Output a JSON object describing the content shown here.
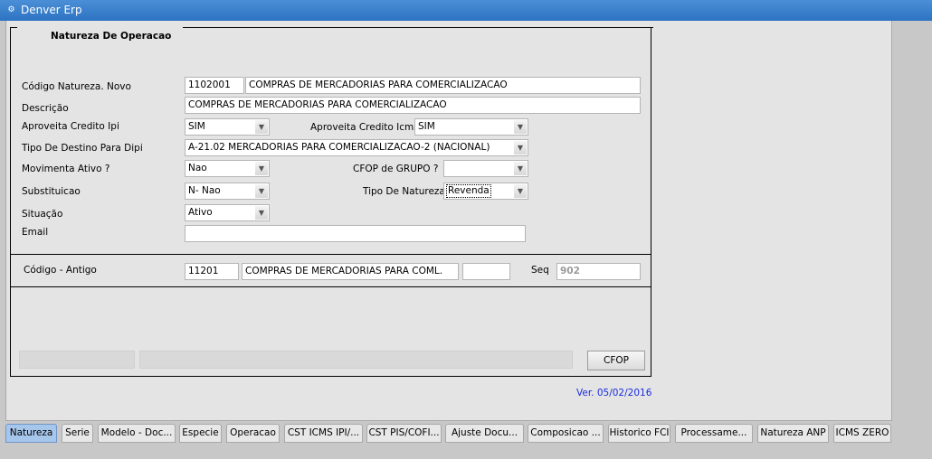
{
  "window": {
    "title": "Denver Erp",
    "icon": "app-icon"
  },
  "panel": {
    "title": "Natureza De Operacao"
  },
  "fields": {
    "codigo_novo": {
      "label": "Código Natureza. Novo",
      "code": "1102001",
      "desc": "COMPRAS DE MERCADORIAS PARA COMERCIALIZACAO"
    },
    "descricao": {
      "label": "Descrição",
      "value": "COMPRAS DE MERCADORIAS PARA COMERCIALIZACAO"
    },
    "aproveita_ipi": {
      "label": "Aproveita Credito Ipi",
      "value": "SIM"
    },
    "aproveita_icms": {
      "label": "Aproveita Credito Icms",
      "value": "SIM"
    },
    "tipo_destino": {
      "label": "Tipo De Destino Para Dipi",
      "value": "A-21.02 MERCADORIAS PARA COMERCIALIZACAO-2 (NACIONAL)"
    },
    "movimenta_ativo": {
      "label": "Movimenta Ativo ?",
      "value": "Nao"
    },
    "cfop_grupo": {
      "label": "CFOP de GRUPO ?",
      "value": ""
    },
    "substituicao": {
      "label": "Substituicao",
      "value": "N- Nao"
    },
    "tipo_natureza": {
      "label": "Tipo De Natureza",
      "value": "Revenda"
    },
    "situacao": {
      "label": "Situação",
      "value": "Ativo"
    },
    "email": {
      "label": "Email",
      "value": ""
    },
    "codigo_antigo": {
      "label": "Código - Antigo",
      "code": "11201",
      "desc": "COMPRAS DE MERCADORIAS PARA COML.",
      "extra": ""
    },
    "seq": {
      "label": "Seq",
      "value": "902"
    }
  },
  "buttons": {
    "cfop": "CFOP"
  },
  "version": "Ver. 05/02/2016",
  "tabs": [
    {
      "label": "Natureza",
      "active": true
    },
    {
      "label": "Serie"
    },
    {
      "label": "Modelo - Doc..."
    },
    {
      "label": "Especie"
    },
    {
      "label": "Operacao"
    },
    {
      "label": "CST ICMS IPI/..."
    },
    {
      "label": "CST PIS/COFI..."
    },
    {
      "label": "Ajuste Docu..."
    },
    {
      "label": "Composicao ..."
    },
    {
      "label": "Historico FCI"
    },
    {
      "label": "Processame..."
    },
    {
      "label": "Natureza ANP"
    },
    {
      "label": "ICMS ZERO"
    }
  ],
  "colors": {
    "titlebar": "#3a80cc",
    "active_tab": "#a7c6ec",
    "version_text": "#1a2ce0"
  }
}
